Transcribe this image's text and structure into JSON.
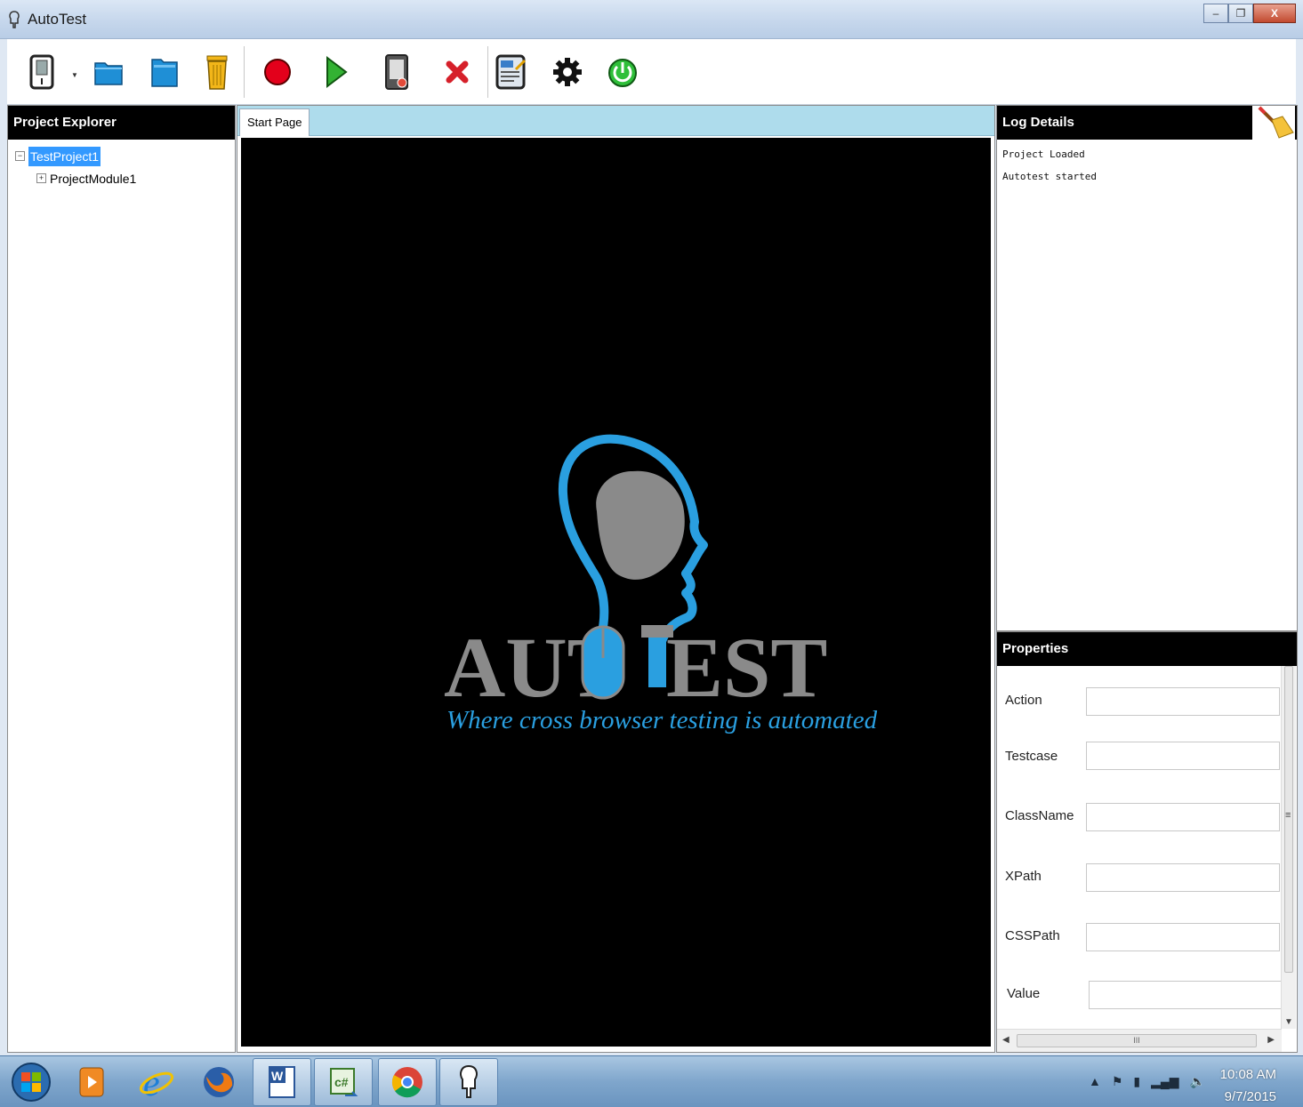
{
  "window": {
    "title": "AutoTest"
  },
  "window_controls": {
    "minimize": "–",
    "restore": "❐",
    "close": "X"
  },
  "toolbar": {
    "icons": [
      "new-project-icon",
      "open-folder-icon",
      "save-icon",
      "delete-icon",
      "record-icon",
      "play-icon",
      "device-icon",
      "stop-icon",
      "report-icon",
      "settings-icon",
      "power-icon"
    ],
    "colors": {
      "record": "#e3001b",
      "play": "#33b233",
      "stop": "#d6202a",
      "power": "#2fbf3a",
      "folder": "#1f8fd6",
      "trash": "#f2b619"
    }
  },
  "project_explorer": {
    "title": "Project Explorer",
    "tree": [
      {
        "label": "TestProject1",
        "expander": "−"
      },
      {
        "label": "ProjectModule1",
        "expander": "+"
      }
    ]
  },
  "tabs": [
    {
      "label": "Start Page"
    }
  ],
  "logo": {
    "wordmark_left": "AUT",
    "wordmark_right": "EST",
    "tagline": "Where cross browser testing is automated",
    "colors": {
      "accent": "#2a9fe0",
      "gray": "#8a8a8a"
    }
  },
  "log_details": {
    "title": "Log Details",
    "entries": [
      "Project Loaded",
      "Autotest started"
    ]
  },
  "properties": {
    "title": "Properties",
    "fields": [
      {
        "label": "Action",
        "value": ""
      },
      {
        "label": "Testcase",
        "value": ""
      },
      {
        "label": "ClassName",
        "value": ""
      },
      {
        "label": "XPath",
        "value": ""
      },
      {
        "label": "CSSPath",
        "value": ""
      },
      {
        "label": "Value",
        "value": ""
      }
    ],
    "hscroll_thumb": "III",
    "vscroll_grip": "≡"
  },
  "taskbar": {
    "items": [
      "start-orb-icon",
      "media-player-icon",
      "internet-explorer-icon",
      "firefox-icon",
      "word-icon",
      "csharp-icon",
      "chrome-icon",
      "autotest-icon"
    ],
    "clock": {
      "time": "10:08 AM",
      "date": "9/7/2015"
    }
  }
}
